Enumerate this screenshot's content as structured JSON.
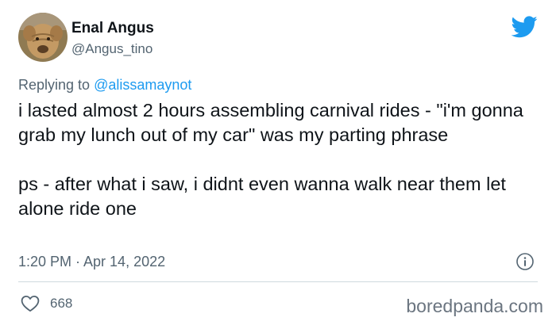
{
  "tweet": {
    "author": {
      "display_name": "Enal Angus",
      "handle": "@Angus_tino"
    },
    "reply": {
      "prefix": "Replying to ",
      "mention": "@alissamaynot"
    },
    "paragraphs": [
      "i lasted almost 2 hours assembling carnival rides - \"i'm gonna grab my lunch out of my car\" was my parting phrase",
      "ps - after what i saw, i didnt even wanna walk near them let alone ride one"
    ],
    "timestamp": "1:20 PM · Apr 14, 2022",
    "like_count": "668"
  },
  "watermark": "boredpanda.com",
  "icons": {
    "brand": "twitter-bird-icon",
    "info": "info-icon",
    "like": "heart-icon"
  },
  "colors": {
    "twitter_blue": "#1d9bf0",
    "text_primary": "#0f1419",
    "text_secondary": "#536471",
    "divider": "#cfd9de"
  }
}
